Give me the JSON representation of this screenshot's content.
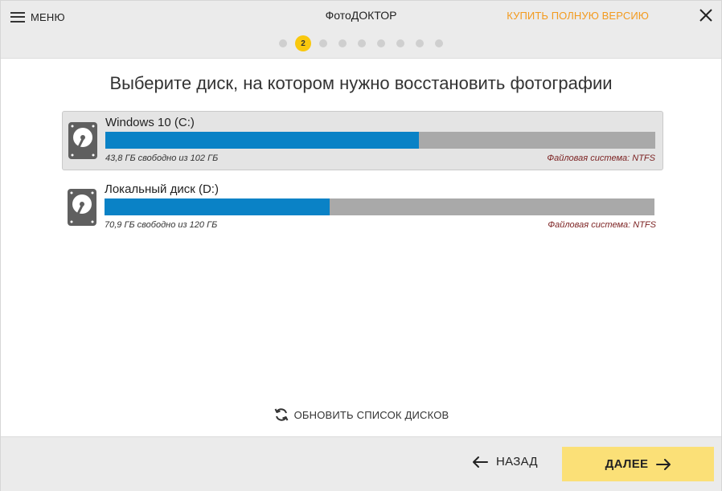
{
  "header": {
    "menu_label": "МЕНЮ",
    "app_title": "ФотоДОКТОР",
    "buy_label": "КУПИТЬ ПОЛНУЮ ВЕРСИЮ",
    "steps_total": 9,
    "current_step": 2,
    "current_step_label": "2"
  },
  "main": {
    "title": "Выберите диск, на котором нужно восстановить фотографии",
    "disks": [
      {
        "name": "Windows 10 (C:)",
        "free_text": "43,8 ГБ свободно из 102 ГБ",
        "fs_text": "Файловая система: NTFS",
        "used_fraction": 0.57,
        "selected": true
      },
      {
        "name": "Локальный диск (D:)",
        "free_text": "70,9 ГБ свободно из 120 ГБ",
        "fs_text": "Файловая система: NTFS",
        "used_fraction": 0.41,
        "selected": false
      }
    ],
    "refresh_label": "ОБНОВИТЬ СПИСОК ДИСКОВ"
  },
  "footer": {
    "back_label": "НАЗАД",
    "next_label": "ДАЛЕЕ"
  },
  "colors": {
    "accent_yellow": "#f9c80e",
    "buy_orange": "#f39a1e",
    "bar_blue": "#0a82c6",
    "bar_gray": "#a9a9a9",
    "next_button": "#fbe077",
    "fs_text": "#7a1f1f"
  }
}
